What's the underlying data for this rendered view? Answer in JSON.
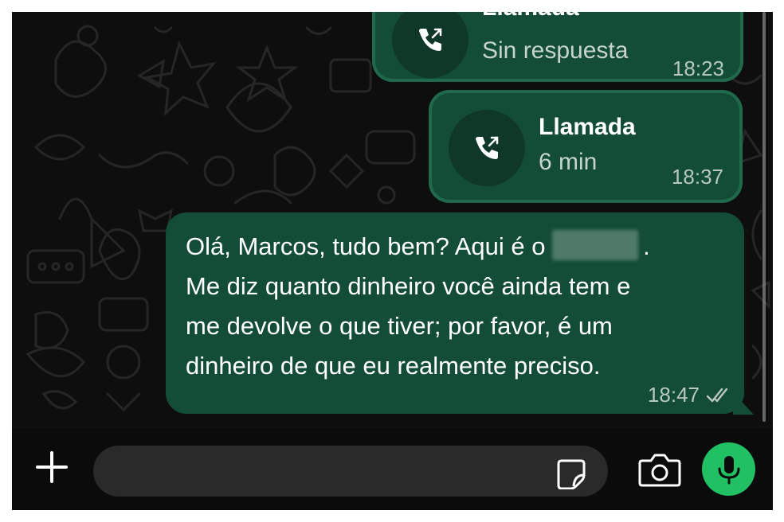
{
  "messages": {
    "call1": {
      "title": "Llamada",
      "status": "Sin respuesta",
      "time": "18:23"
    },
    "call2": {
      "title": "Llamada",
      "status": "6 min",
      "time": "18:37"
    },
    "text_message": {
      "lines": [
        "Olá, Marcos, tudo bem? Aqui é o",
        "Me diz quanto dinheiro você ainda tem e",
        "me devolve o que tiver; por favor, é um",
        "dinheiro de que eu realmente preciso."
      ],
      "line1_end": ".",
      "time": "18:47",
      "read_status_icon": "double-check-icon"
    }
  },
  "composer": {
    "plus_icon": "plus-icon",
    "sticker_icon": "sticker-icon",
    "camera_icon": "camera-icon",
    "mic_icon": "microphone-icon"
  },
  "colors": {
    "bubble": "#144d37",
    "bubble_border": "#1f6a4b",
    "accent_green": "#21c063",
    "background": "#0e0e0e"
  }
}
